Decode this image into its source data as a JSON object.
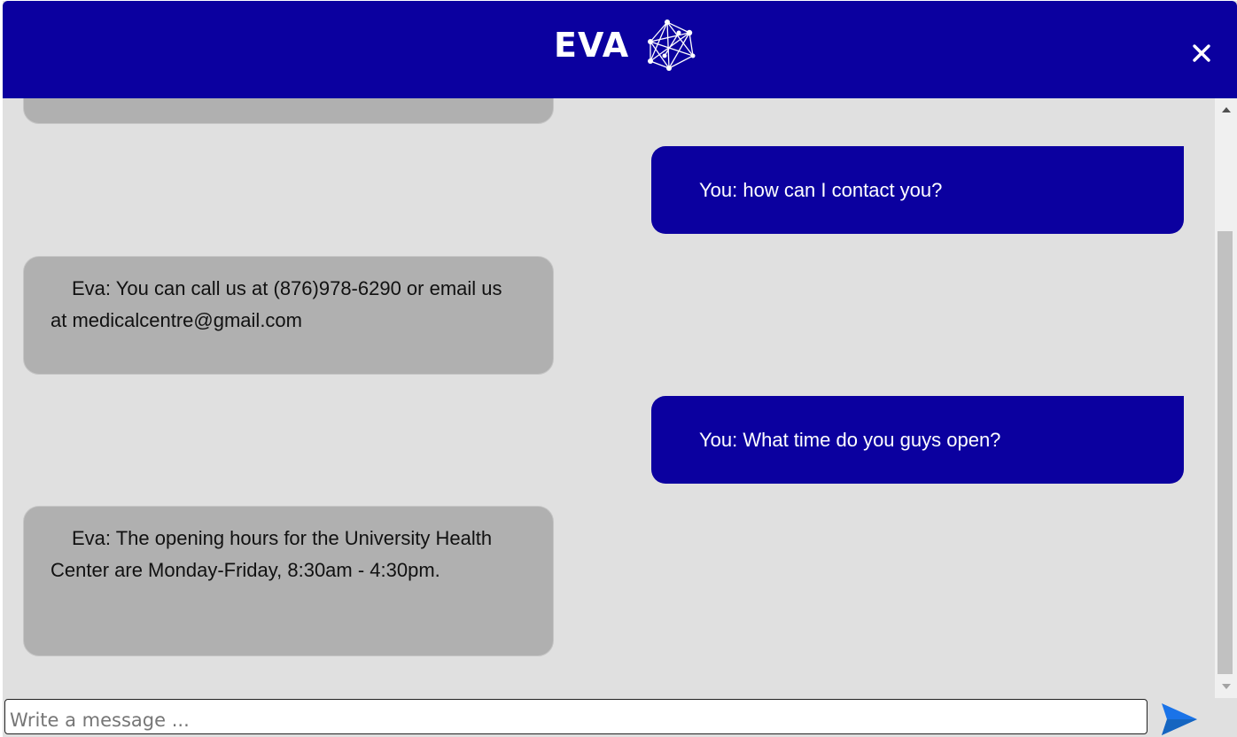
{
  "header": {
    "title": "EVA",
    "logo_icon": "network-nodes-icon",
    "close_icon": "close-icon"
  },
  "messages": [
    {
      "sender": "bot",
      "text": ""
    },
    {
      "sender": "user",
      "text": "You: how can I contact you?"
    },
    {
      "sender": "bot",
      "text": "Eva: You can call us at (876)978-6290 or email us at medicalcentre@gmail.com"
    },
    {
      "sender": "user",
      "text": "You: What time do you guys open?"
    },
    {
      "sender": "bot",
      "text": "Eva: The opening hours for the University Health Center are Monday-Friday, 8:30am - 4:30pm."
    }
  ],
  "composer": {
    "value": "",
    "placeholder": "Write a message ...",
    "send_icon": "send-arrow-icon"
  },
  "colors": {
    "brand": "#0b009f",
    "bot_bubble": "#b0b0b0",
    "background": "#e0e0e0",
    "send_icon": "#1a73e8"
  }
}
